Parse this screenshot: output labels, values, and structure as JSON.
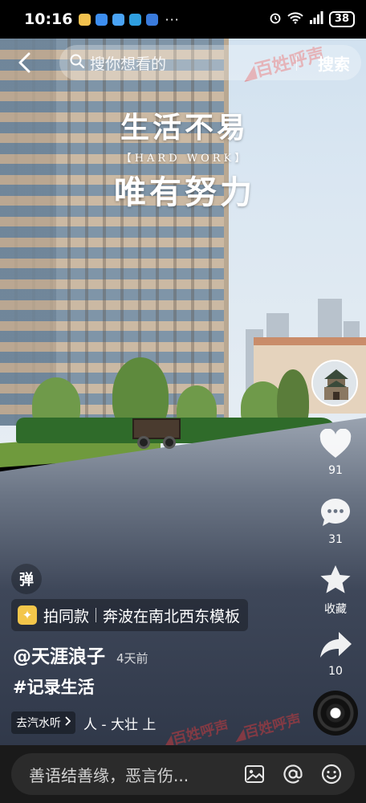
{
  "status_bar": {
    "time": "10:16",
    "battery": "38",
    "more_glyph": "···"
  },
  "search": {
    "placeholder": "搜你想看的",
    "button_label": "搜索"
  },
  "video_overlay": {
    "line1": "生活不易",
    "line2": "【HARD WORK】",
    "line3": "唯有努力"
  },
  "actions": {
    "like_count": "91",
    "comment_count": "31",
    "favorite_label": "收藏",
    "share_count": "10"
  },
  "danmaku": {
    "label": "弹"
  },
  "template": {
    "label": "拍同款",
    "name": "奔波在南北西东模板"
  },
  "author": {
    "name": "@天涯浪子",
    "post_time": "4天前"
  },
  "hashtag": "#记录生活",
  "music": {
    "source_label": "去汽水听",
    "title": "人 - 大壮    上"
  },
  "comment_bar": {
    "placeholder": "善语结善缘，恶言伤..."
  },
  "colors": {
    "status_bg": "#000000",
    "comment_bar_bg": "#1a1a1a",
    "template_accent": "#f3c64a"
  }
}
